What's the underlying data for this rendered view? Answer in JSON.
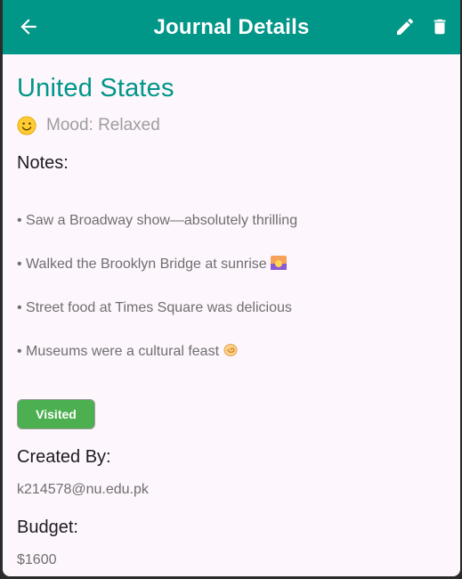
{
  "appbar": {
    "title": "Journal Details",
    "back_icon": "arrow-back-icon",
    "edit_icon": "pencil-icon",
    "delete_icon": "trash-icon",
    "color": "#009688"
  },
  "journal": {
    "destination": "United States",
    "mood_label": "Mood: Relaxed",
    "mood_icon": "smiling-face-icon",
    "notes_heading": "Notes:",
    "notes": [
      "• Saw a Broadway show—absolutely thrilling",
      "• Walked the Brooklyn Bridge at sunrise",
      "• Street food at Times Square was delicious",
      "• Museums were a cultural feast"
    ],
    "status_badge": "Visited",
    "created_by_heading": "Created By:",
    "created_by": "k214578@nu.edu.pk",
    "budget_heading": "Budget:",
    "budget": "$1600"
  }
}
